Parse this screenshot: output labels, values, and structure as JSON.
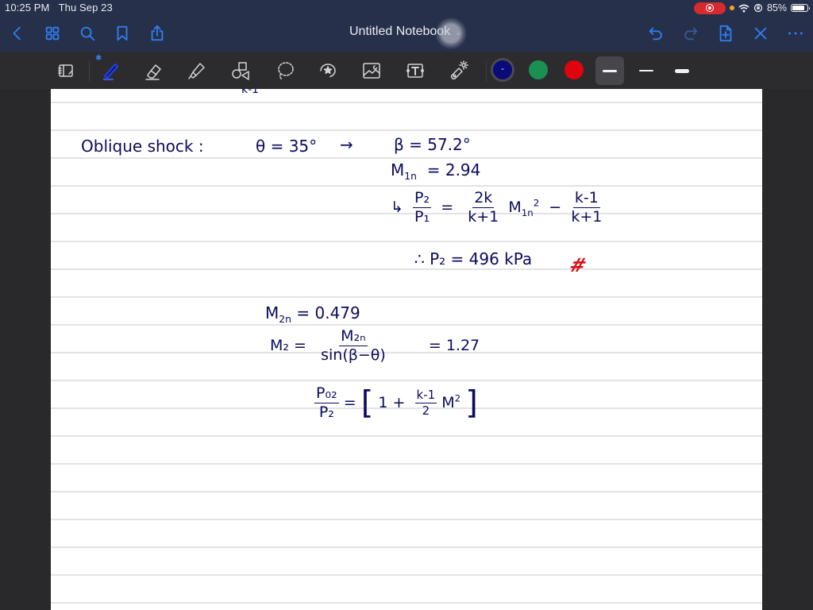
{
  "status_bar": {
    "time": "10:25 PM",
    "date": "Thu Sep 23",
    "battery_percent": 85,
    "battery_label": "85%",
    "recording_icon": "screen-record-icon",
    "wifi_icon": "wifi-icon",
    "orientation_lock_icon": "orientation-lock-icon"
  },
  "nav_bar": {
    "title": "Untitled Notebook",
    "title_chevron": "⌄",
    "left_icons": [
      "back-icon",
      "grid-icon",
      "search-icon",
      "bookmark-icon",
      "share-icon"
    ],
    "right_icons": [
      "undo-icon",
      "redo-icon",
      "add-page-icon",
      "close-icon",
      "more-icon"
    ],
    "accent_color": "#2f7ff0"
  },
  "toolbar": {
    "tools": [
      "page-layout-icon",
      "pen-icon",
      "eraser-icon",
      "highlighter-icon",
      "shapes-icon",
      "lasso-icon",
      "sticker-icon",
      "image-icon",
      "text-icon",
      "laser-pointer-icon"
    ],
    "active_tool": "pen-icon",
    "bluetooth_badge": "✱",
    "colors": [
      {
        "name": "navy",
        "hex": "#0a0a78",
        "selected": true,
        "chevron": "⌄"
      },
      {
        "name": "green",
        "hex": "#1a9150",
        "selected": false
      },
      {
        "name": "red",
        "hex": "#e0040d",
        "selected": false
      }
    ],
    "stroke_widths": [
      {
        "name": "medium",
        "selected": true
      },
      {
        "name": "thin",
        "selected": false
      },
      {
        "name": "thick",
        "selected": false
      }
    ]
  },
  "notes": {
    "partial_top": "k-1",
    "oblique_label": "Oblique shock :",
    "theta": "θ = 35°",
    "arrow": "→",
    "beta": "β = 57.2°",
    "m1n_lhs": "M",
    "m1n_sub": "1n",
    "m1n_val": "= 2.94",
    "hook": "↳",
    "p_ratio_num": "P₂",
    "p_ratio_den": "P₁",
    "eq1": "=",
    "f1_num": "2k",
    "f1_den": "k+1",
    "m1n2": "M",
    "m1n2_sub": "1n",
    "m1n2_sup": "2",
    "minus": "−",
    "f2_num": "k-1",
    "f2_den": "k+1",
    "therefore": "∴",
    "p2_result": "P₂ = 496 kPa",
    "answer_mark": "#",
    "m2n_lhs": "M",
    "m2n_sub": "2n",
    "m2n_val": "= 0.479",
    "m2_lhs": "M₂ =",
    "m2_num": "M₂ₙ",
    "m2_den": "sin(β−θ)",
    "m2_val": "= 1.27",
    "p02_num": "P₀₂",
    "p02_den": "P₂",
    "p02_eq": "=",
    "bracket_open": "[",
    "one_plus": "1 +",
    "k_num": "k-1",
    "k_den": "2",
    "m_sq": "M",
    "m_sq_sup": "2",
    "bracket_close": "]"
  }
}
